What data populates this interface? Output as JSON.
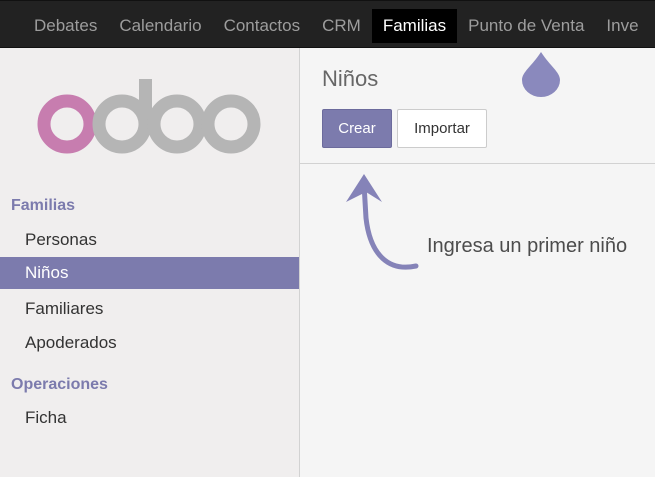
{
  "top_menu": {
    "items": [
      {
        "label": "Debates"
      },
      {
        "label": "Calendario"
      },
      {
        "label": "Contactos"
      },
      {
        "label": "CRM"
      },
      {
        "label": "Familias",
        "active": true
      },
      {
        "label": "Punto de Venta"
      },
      {
        "label": "Inve"
      }
    ]
  },
  "sidebar": {
    "logo_icon": "odoo-logo",
    "sections": [
      {
        "title": "Familias",
        "items": [
          {
            "label": "Personas"
          },
          {
            "label": "Niños",
            "active": true
          },
          {
            "label": "Familiares"
          },
          {
            "label": "Apoderados"
          }
        ]
      },
      {
        "title": "Operaciones",
        "items": [
          {
            "label": "Ficha"
          }
        ]
      }
    ]
  },
  "main": {
    "title": "Niños",
    "buttons": {
      "create_label": "Crear",
      "import_label": "Importar"
    },
    "help_text": "Ingresa un primer niño",
    "icons": {
      "drop": "drop-icon",
      "arrow": "curved-arrow-up-icon"
    }
  },
  "colors": {
    "accent": "#7c7bad",
    "topbar": "#222222",
    "logo_o": "#c77daf",
    "logo_grey": "#b5b5b5"
  }
}
